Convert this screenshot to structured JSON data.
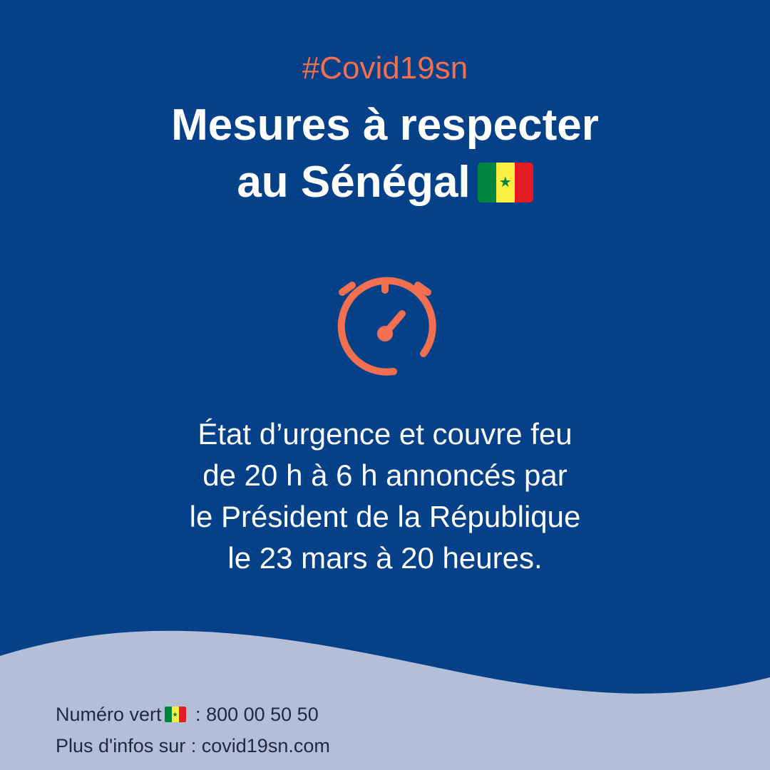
{
  "header": {
    "hashtag": "#Covid19sn",
    "title_line1": "Mesures à respecter",
    "title_line2": "au Sénégal"
  },
  "icons": {
    "flag": "senegal-flag-icon",
    "timer": "stopwatch-icon",
    "flag_star": "★"
  },
  "message": {
    "line1": "État d’urgence et couvre feu",
    "line2": "de 20 h à 6 h annoncés par",
    "line3": "le Président de la République",
    "line4": "le 23 mars à 20 heures."
  },
  "footer": {
    "hotline_label": "Numéro vert",
    "hotline_sep": " : ",
    "hotline_number": "800 00 50 50",
    "info_label": "Plus d'infos sur : ",
    "info_site": "covid19sn.com"
  },
  "colors": {
    "background": "#044189",
    "accent": "#f26f4f",
    "wave": "#b2bfd6",
    "text_light": "#ffffff",
    "text_dark": "#1c2a44",
    "flag_green": "#00853f",
    "flag_yellow": "#fdef42",
    "flag_red": "#e31b23"
  }
}
